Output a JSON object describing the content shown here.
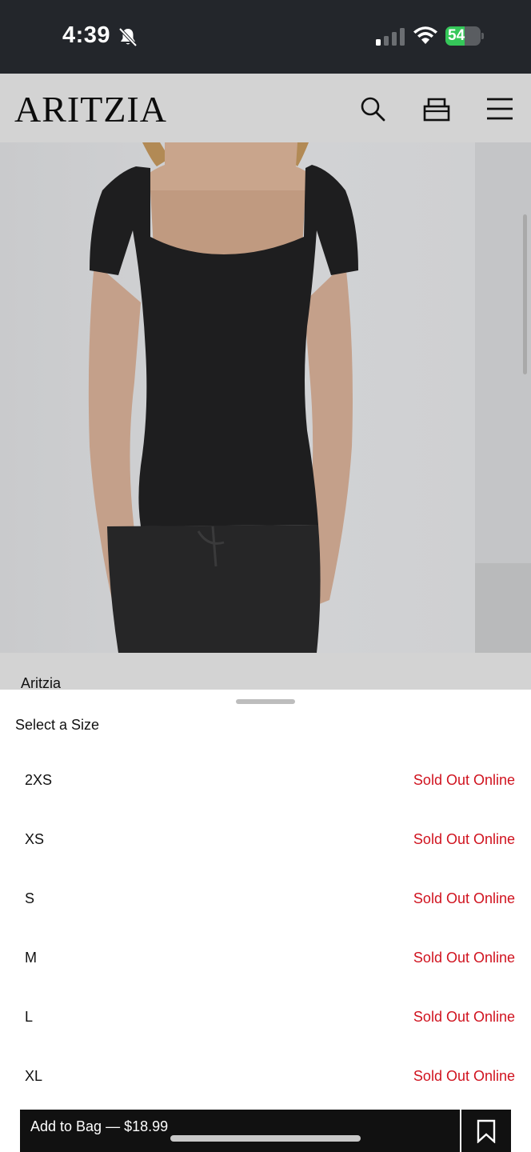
{
  "status_bar": {
    "time": "4:39",
    "battery": "54",
    "battery_level": 0.54
  },
  "nav": {
    "brand": "ARITZIA",
    "icons": [
      "search-icon",
      "bag-icon",
      "menu-icon"
    ]
  },
  "product": {
    "brand_caption": "Aritzia"
  },
  "size_sheet": {
    "title": "Select a Size",
    "sizes": [
      {
        "label": "2XS",
        "status": "Sold Out Online"
      },
      {
        "label": "XS",
        "status": "Sold Out Online"
      },
      {
        "label": "S",
        "status": "Sold Out Online"
      },
      {
        "label": "M",
        "status": "Sold Out Online"
      },
      {
        "label": "L",
        "status": "Sold Out Online"
      },
      {
        "label": "XL",
        "status": "Sold Out Online"
      }
    ],
    "add_to_bag": "Add to Bag — $18.99"
  },
  "colors": {
    "sold_out": "#d0131f",
    "status_bar": "#23262b",
    "button": "#111111"
  }
}
